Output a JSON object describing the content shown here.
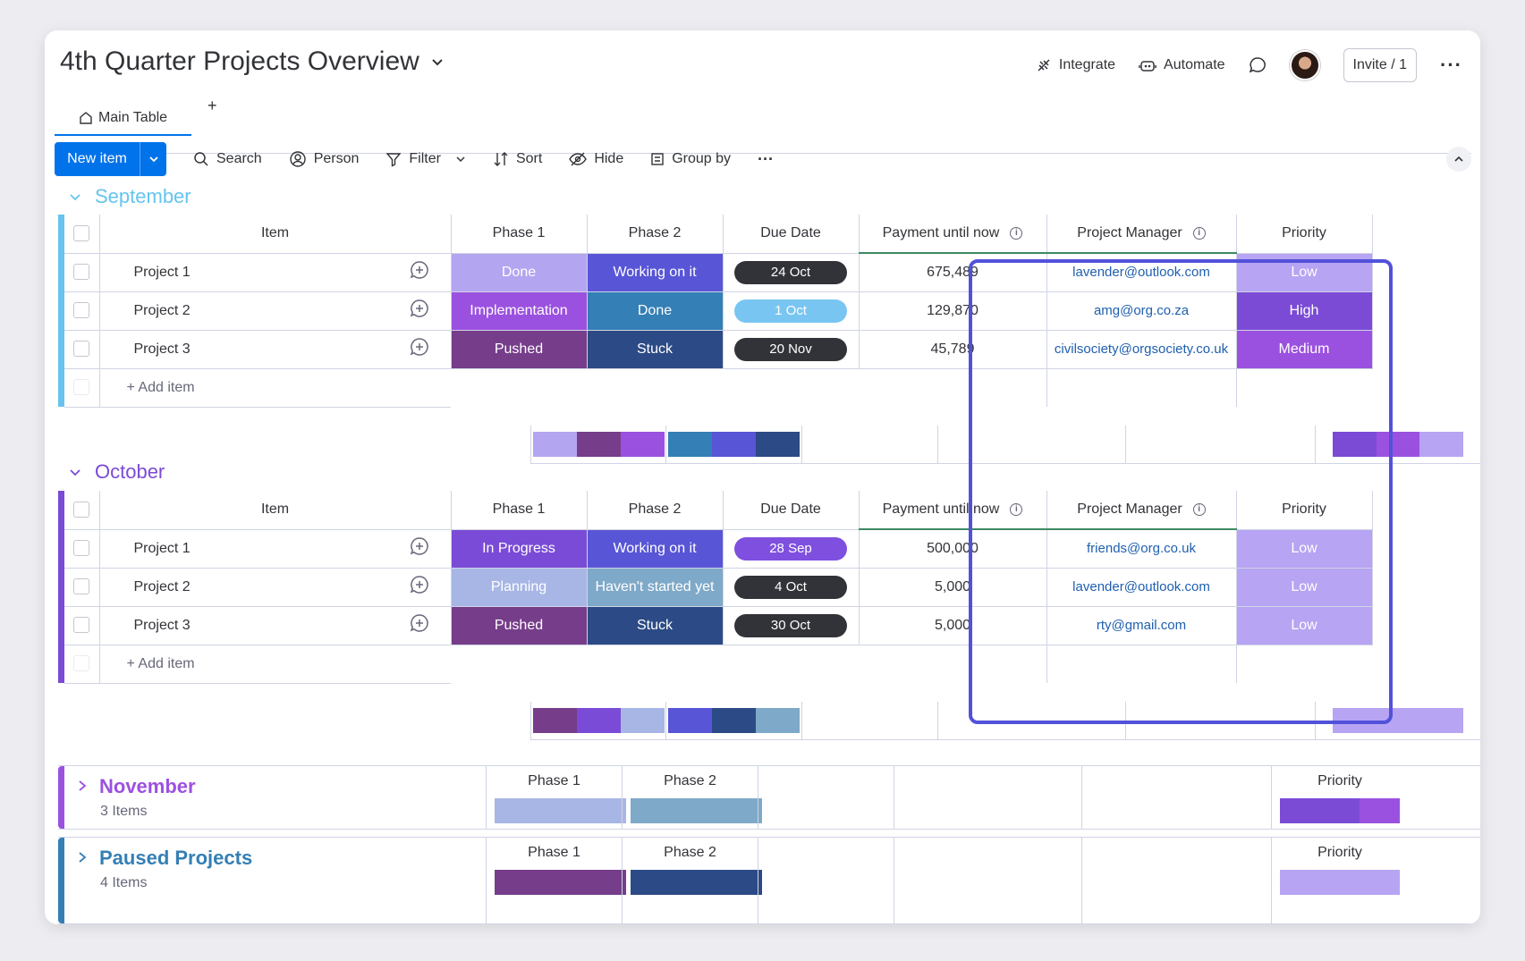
{
  "board": {
    "title": "4th Quarter Projects Overview",
    "actions": {
      "integrate": "Integrate",
      "automate": "Automate",
      "invite": "Invite / 1",
      "more": "···"
    }
  },
  "tabs": {
    "main": "Main Table",
    "add": "+"
  },
  "toolbar": {
    "new_item": "New item",
    "search": "Search",
    "person": "Person",
    "filter": "Filter",
    "sort": "Sort",
    "hide": "Hide",
    "group_by": "Group by",
    "more": "···"
  },
  "columns": {
    "item": "Item",
    "phase1": "Phase 1",
    "phase2": "Phase 2",
    "due": "Due Date",
    "payment": "Payment until now",
    "manager": "Project Manager",
    "priority": "Priority"
  },
  "add_item": "+ Add item",
  "colors": {
    "done_light": "#b4a5f0",
    "working": "#5855d6",
    "implementation": "#9b51e0",
    "done_blue": "#347fb5",
    "pushed": "#763d8a",
    "stuck": "#2c4a85",
    "in_progress": "#7a4bd6",
    "planning": "#a8b6e6",
    "not_started": "#7fa9c8",
    "low": "#b7a4f3",
    "high": "#7b4bd6",
    "medium": "#9b51e0",
    "pill_dark": "#323338",
    "pill_sky": "#79c5f2",
    "pill_purple": "#7f4fdf"
  },
  "groups": [
    {
      "name": "September",
      "color": "#66c4ee",
      "rows": [
        {
          "item": "Project 1",
          "phase1": "Done",
          "phase1_color": "#b4a5f0",
          "phase2": "Working on it",
          "phase2_color": "#5855d6",
          "due": "24 Oct",
          "due_color": "#323338",
          "payment": "675,489",
          "manager": "lavender@outlook.com",
          "priority": "Low",
          "priority_color": "#b7a4f3"
        },
        {
          "item": "Project 2",
          "phase1": "Implementation",
          "phase1_color": "#9b51e0",
          "phase2": "Done",
          "phase2_color": "#347fb5",
          "due": "1 Oct",
          "due_color": "#79c5f2",
          "payment": "129,870",
          "manager": "amg@org.co.za",
          "priority": "High",
          "priority_color": "#7b4bd6"
        },
        {
          "item": "Project 3",
          "phase1": "Pushed",
          "phase1_color": "#763d8a",
          "phase2": "Stuck",
          "phase2_color": "#2c4a85",
          "due": "20 Nov",
          "due_color": "#323338",
          "payment": "45,789",
          "manager": "civilsociety@orgsociety.co.uk",
          "priority": "Medium",
          "priority_color": "#9b51e0"
        }
      ],
      "summary": {
        "phase1": [
          "#b4a5f0",
          "#763d8a",
          "#9b51e0"
        ],
        "phase2": [
          "#347fb5",
          "#5855d6",
          "#2c4a85"
        ],
        "priority": [
          "#7b4bd6",
          "#9b51e0",
          "#b7a4f3"
        ]
      }
    },
    {
      "name": "October",
      "color": "#7a4bd6",
      "rows": [
        {
          "item": "Project 1",
          "phase1": "In Progress",
          "phase1_color": "#7a4bd6",
          "phase2": "Working on it",
          "phase2_color": "#5855d6",
          "due": "28 Sep",
          "due_color": "#7f4fdf",
          "payment": "500,000",
          "manager": "friends@org.co.uk",
          "priority": "Low",
          "priority_color": "#b7a4f3"
        },
        {
          "item": "Project 2",
          "phase1": "Planning",
          "phase1_color": "#a8b6e6",
          "phase2": "Haven't started yet",
          "phase2_color": "#7fa9c8",
          "due": "4 Oct",
          "due_color": "#323338",
          "payment": "5,000",
          "manager": "lavender@outlook.com",
          "priority": "Low",
          "priority_color": "#b7a4f3"
        },
        {
          "item": "Project 3",
          "phase1": "Pushed",
          "phase1_color": "#763d8a",
          "phase2": "Stuck",
          "phase2_color": "#2c4a85",
          "due": "30 Oct",
          "due_color": "#323338",
          "payment": "5,000",
          "manager": "rty@gmail.com",
          "priority": "Low",
          "priority_color": "#b7a4f3"
        }
      ],
      "summary": {
        "phase1": [
          "#763d8a",
          "#7a4bd6",
          "#a8b6e6"
        ],
        "phase2": [
          "#5855d6",
          "#2c4a85",
          "#7fa9c8"
        ],
        "priority": [
          "#b7a4f3"
        ]
      }
    }
  ],
  "collapsed_groups": [
    {
      "name": "November",
      "count": "3 Items",
      "color": "#9b51e0",
      "phase1_bar": [
        "#a8b6e6"
      ],
      "phase2_bar": [
        "#7fa9c8"
      ],
      "priority_bar": [
        "#7b4bd6",
        "#7b4bd6",
        "#9b51e0"
      ]
    },
    {
      "name": "Paused Projects",
      "count": "4 Items",
      "color": "#347fb5",
      "phase1_bar": [
        "#763d8a"
      ],
      "phase2_bar": [
        "#2c4a85"
      ],
      "priority_bar": [
        "#b7a4f3"
      ]
    }
  ]
}
